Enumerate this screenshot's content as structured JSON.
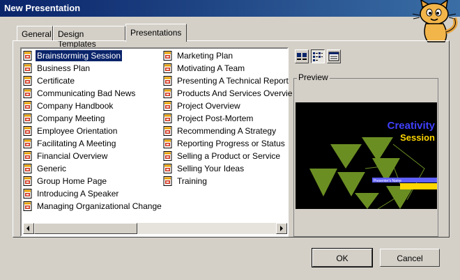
{
  "window": {
    "title": "New Presentation"
  },
  "tabs": [
    {
      "label": "General"
    },
    {
      "label": "Design Templates"
    },
    {
      "label": "Presentations"
    }
  ],
  "templates": {
    "column1": [
      "Brainstorming Session",
      "Business Plan",
      "Certificate",
      "Communicating Bad News",
      "Company Handbook",
      "Company Meeting",
      "Employee Orientation",
      "Facilitating A Meeting",
      "Financial Overview",
      "Generic",
      "Group Home Page",
      "Introducing A Speaker",
      "Managing Organizational Change"
    ],
    "column2": [
      "Marketing Plan",
      "Motivating A Team",
      "Presenting A Technical Report",
      "Products And Services Overvie",
      "Project Overview",
      "Project Post-Mortem",
      "Recommending A Strategy",
      "Reporting Progress or Status",
      "Selling a Product or Service",
      "Selling Your Ideas",
      "Training"
    ],
    "selected": "Brainstorming Session"
  },
  "view_buttons": [
    {
      "icon": "large-icons-view-icon"
    },
    {
      "icon": "list-view-icon",
      "pressed": true
    },
    {
      "icon": "details-view-icon"
    }
  ],
  "preview": {
    "label": "Preview",
    "slide_title": "Creativity",
    "slide_subtitle": "Session",
    "presenter_label": "Presenter's Name"
  },
  "buttons": {
    "ok": "OK",
    "cancel": "Cancel"
  },
  "colors": {
    "title_bar": "#0a246a",
    "selection": "#0a246a",
    "slide_bg": "#000000",
    "slide_title": "#4040ff",
    "slide_subtitle": "#ffd700",
    "slide_shapes": "#6b8e23"
  }
}
